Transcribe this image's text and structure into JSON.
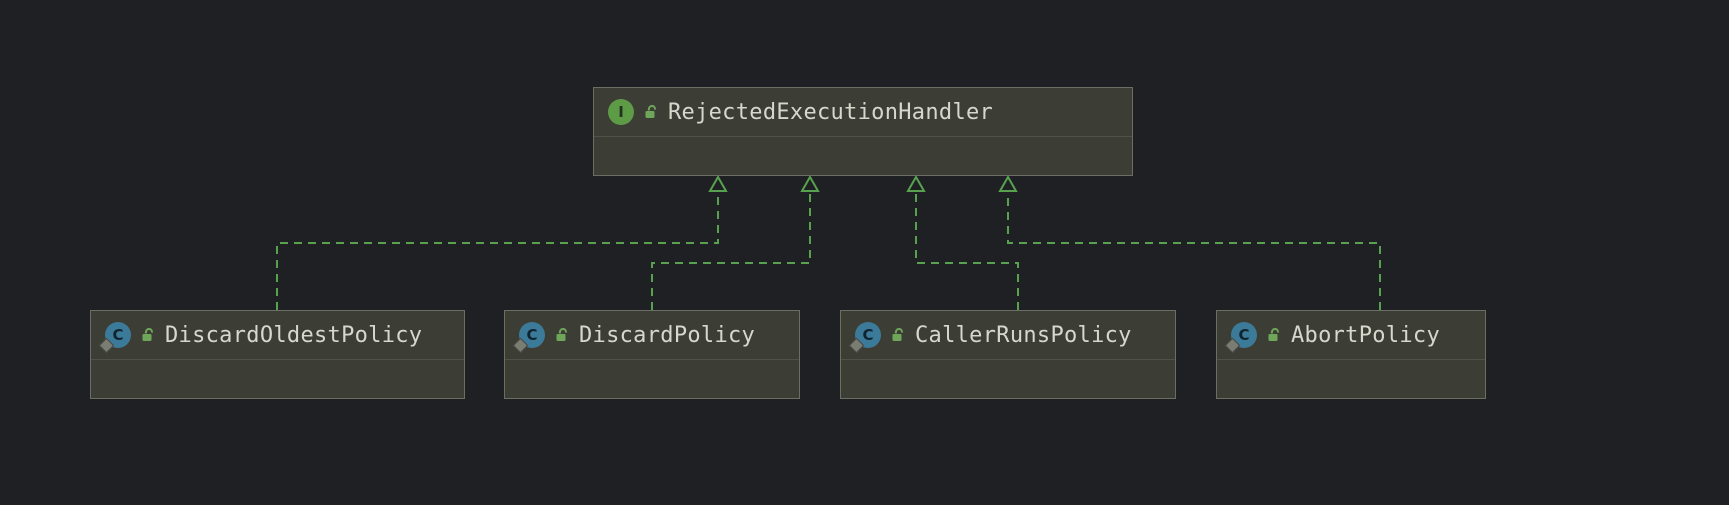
{
  "diagram": {
    "root": {
      "kind": "interface",
      "badge_letter": "I",
      "lock_state": "open",
      "name": "RejectedExecutionHandler"
    },
    "children": [
      {
        "kind": "class",
        "badge_letter": "C",
        "lock_state": "open",
        "name": "DiscardOldestPolicy"
      },
      {
        "kind": "class",
        "badge_letter": "C",
        "lock_state": "open",
        "name": "DiscardPolicy"
      },
      {
        "kind": "class",
        "badge_letter": "C",
        "lock_state": "open",
        "name": "CallerRunsPolicy"
      },
      {
        "kind": "class",
        "badge_letter": "C",
        "lock_state": "open",
        "name": "AbortPolicy"
      }
    ],
    "relationship": "implements"
  },
  "colors": {
    "background": "#1f2023",
    "node_fill": "#3c3e35",
    "node_border": "#6a6e63",
    "connector": "#57a14f",
    "interface_badge": "#5d9b47",
    "class_badge": "#3b7a99",
    "text": "#d7d7cc"
  }
}
